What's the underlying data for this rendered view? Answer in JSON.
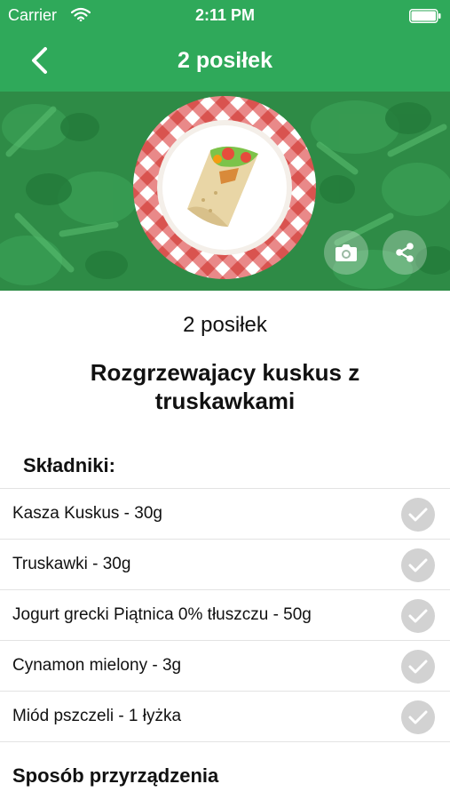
{
  "status_bar": {
    "carrier": "Carrier",
    "time": "2:11 PM"
  },
  "nav": {
    "title": "2 posiłek",
    "back_icon": "chevron-left-icon"
  },
  "hero": {
    "image": "meal-wrap-on-plate",
    "actions": [
      {
        "icon": "camera-icon"
      },
      {
        "icon": "share-icon"
      }
    ]
  },
  "meal": {
    "label": "2 posiłek",
    "title": "Rozgrzewajacy kuskus z truskawkami"
  },
  "ingredients": {
    "heading": "Składniki:",
    "items": [
      {
        "name": "Kasza Kuskus - 30g",
        "checked": false
      },
      {
        "name": "Truskawki - 30g",
        "checked": false
      },
      {
        "name": "Jogurt grecki Piątnica 0% tłuszczu - 50g",
        "checked": false
      },
      {
        "name": "Cynamon mielony - 3g",
        "checked": false
      },
      {
        "name": "Miód pszczeli - 1 łyżka",
        "checked": false
      }
    ]
  },
  "preparation": {
    "heading": "Sposób przyrządzenia"
  },
  "colors": {
    "brand_green": "#2fa95a",
    "check_gray": "#d2d2d2"
  }
}
